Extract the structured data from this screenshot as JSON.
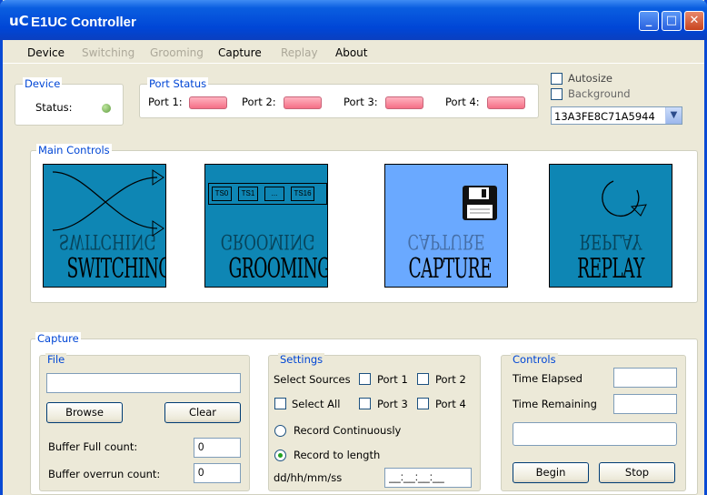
{
  "window": {
    "logo": "uC",
    "title": "E1UC Controller",
    "minimize_glyph": "_",
    "maximize_glyph": "□",
    "close_glyph": "✕"
  },
  "menu": {
    "device": "Device",
    "switching": "Switching",
    "grooming": "Grooming",
    "capture": "Capture",
    "replay": "Replay",
    "about": "About"
  },
  "device_group": {
    "legend": "Device",
    "status_label": "Status:"
  },
  "port_status": {
    "legend": "Port Status",
    "port1": "Port 1:",
    "port2": "Port 2:",
    "port3": "Port 3:",
    "port4": "Port 4:"
  },
  "options": {
    "autosize": "Autosize",
    "background": "Background",
    "serial_selected": "13A3FE8C71A5944"
  },
  "main_controls": {
    "legend": "Main Controls",
    "tiles": {
      "switching": "SWITCHING",
      "grooming": "GROOMING",
      "capture": "CAPTURE",
      "replay": "REPLAY"
    },
    "ts_labels": {
      "ts0": "TS0",
      "ts1": "TS1",
      "dots": "...",
      "ts16": "TS16"
    }
  },
  "capture": {
    "legend": "Capture",
    "file": {
      "legend": "File",
      "path_value": "",
      "browse": "Browse",
      "clear": "Clear",
      "buffer_full_label": "Buffer Full count:",
      "buffer_full_value": "0",
      "buffer_overrun_label": "Buffer overrun count:",
      "buffer_overrun_value": "0"
    },
    "settings": {
      "legend": "Settings",
      "select_sources": "Select Sources",
      "port1": "Port 1",
      "port2": "Port 2",
      "select_all": "Select All",
      "port3": "Port 3",
      "port4": "Port 4",
      "record_continuously": "Record Continuously",
      "record_to_length": "Record to length",
      "length_format": "dd/hh/mm/ss",
      "length_value": "__:__:__:__"
    },
    "controls": {
      "legend": "Controls",
      "time_elapsed": "Time Elapsed",
      "time_remaining": "Time Remaining",
      "begin": "Begin",
      "stop": "Stop"
    }
  }
}
